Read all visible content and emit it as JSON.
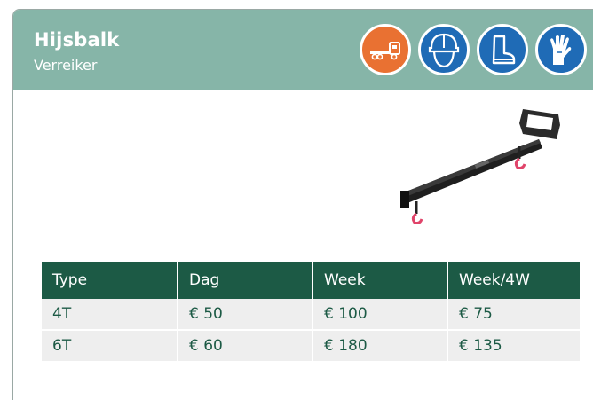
{
  "product": {
    "title": "Hijsbalk",
    "subtitle": "Verreiker"
  },
  "icons": [
    {
      "name": "truck-transport-icon",
      "color": "#e97132"
    },
    {
      "name": "helmet-icon",
      "color": "#1f6bb6"
    },
    {
      "name": "safety-boot-icon",
      "color": "#1f6bb6"
    },
    {
      "name": "gloves-icon",
      "color": "#1f6bb6"
    }
  ],
  "pricing": {
    "headers": [
      "Type",
      "Dag",
      "Week",
      "Week/4W"
    ],
    "rows": [
      [
        "4T",
        "€ 50",
        "€ 100",
        "€ 75"
      ],
      [
        "6T",
        "€ 60",
        "€ 180",
        "€ 135"
      ]
    ]
  },
  "colors": {
    "header_bg": "#86b5a8",
    "table_header": "#1c5a45",
    "accent_orange": "#e97132",
    "ppe_blue": "#1f6bb6"
  }
}
